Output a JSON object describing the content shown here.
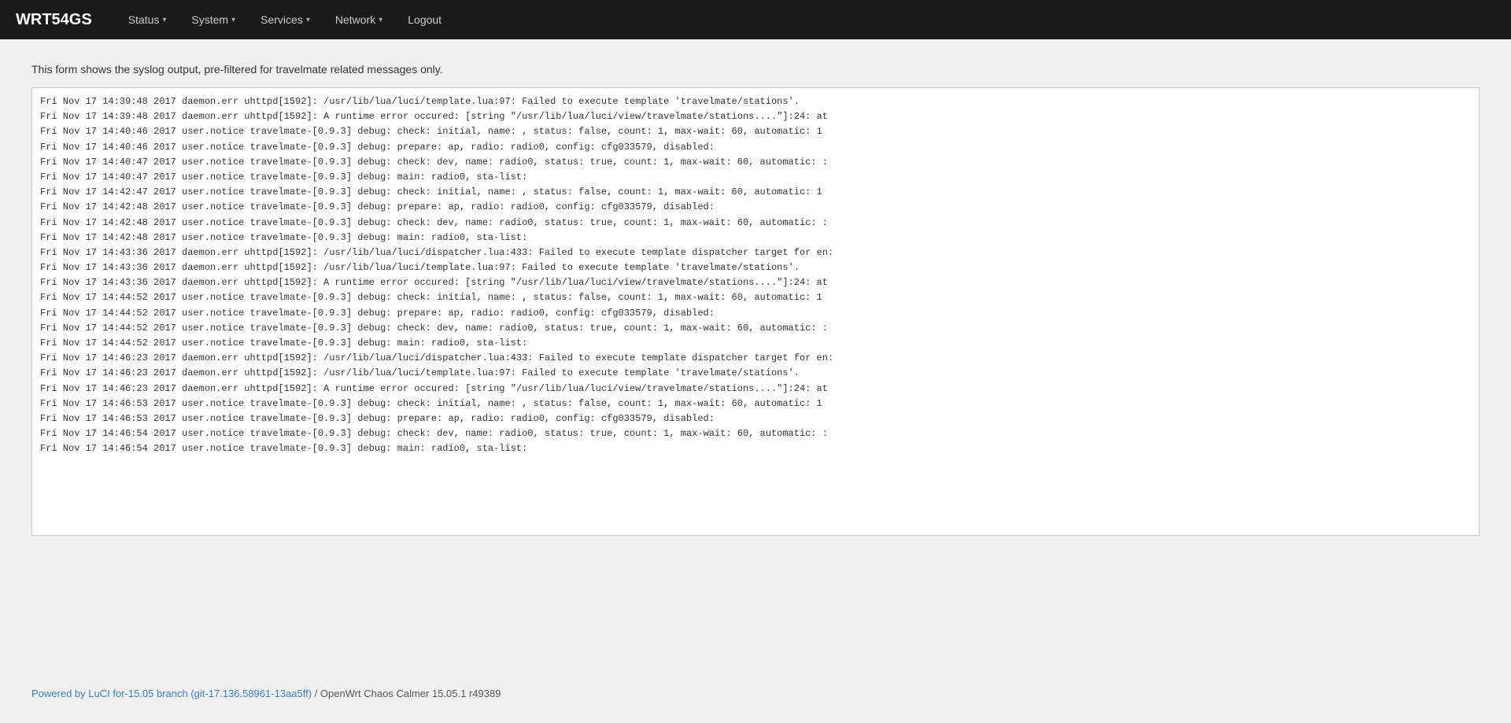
{
  "navbar": {
    "brand": "WRT54GS",
    "items": [
      {
        "label": "Status",
        "has_dropdown": true
      },
      {
        "label": "System",
        "has_dropdown": true
      },
      {
        "label": "Services",
        "has_dropdown": true
      },
      {
        "label": "Network",
        "has_dropdown": true
      },
      {
        "label": "Logout",
        "has_dropdown": false
      }
    ]
  },
  "description": "This form shows the syslog output, pre-filtered for travelmate related messages only.",
  "log_lines": [
    "Fri Nov 17 14:39:48 2017 daemon.err uhttpd[1592]: /usr/lib/lua/luci/template.lua:97: Failed to execute template 'travelmate/stations'.",
    "Fri Nov 17 14:39:48 2017 daemon.err uhttpd[1592]: A runtime error occured: [string \"/usr/lib/lua/luci/view/travelmate/stations....\"]:24: at",
    "Fri Nov 17 14:40:46 2017 user.notice travelmate-[0.9.3] debug: check: initial, name: , status: false, count: 1, max-wait: 60, automatic: 1",
    "Fri Nov 17 14:40:46 2017 user.notice travelmate-[0.9.3] debug: prepare: ap, radio: radio0, config: cfg033579, disabled:",
    "Fri Nov 17 14:40:47 2017 user.notice travelmate-[0.9.3] debug: check: dev, name:  radio0, status: true, count: 1, max-wait: 60, automatic: :",
    "Fri Nov 17 14:40:47 2017 user.notice travelmate-[0.9.3] debug: main:  radio0, sta-list:",
    "Fri Nov 17 14:42:47 2017 user.notice travelmate-[0.9.3] debug: check: initial, name: , status: false, count: 1, max-wait: 60, automatic: 1",
    "Fri Nov 17 14:42:48 2017 user.notice travelmate-[0.9.3] debug: prepare: ap, radio: radio0, config: cfg033579, disabled:",
    "Fri Nov 17 14:42:48 2017 user.notice travelmate-[0.9.3] debug: check: dev, name:  radio0, status: true, count: 1, max-wait: 60, automatic: :",
    "Fri Nov 17 14:42:48 2017 user.notice travelmate-[0.9.3] debug: main:  radio0, sta-list:",
    "Fri Nov 17 14:43:36 2017 daemon.err uhttpd[1592]: /usr/lib/lua/luci/dispatcher.lua:433: Failed to execute template dispatcher target for en:",
    "Fri Nov 17 14:43:36 2017 daemon.err uhttpd[1592]: /usr/lib/lua/luci/template.lua:97: Failed to execute template 'travelmate/stations'.",
    "Fri Nov 17 14:43:36 2017 daemon.err uhttpd[1592]: A runtime error occured: [string \"/usr/lib/lua/luci/view/travelmate/stations....\"]:24: at",
    "Fri Nov 17 14:44:52 2017 user.notice travelmate-[0.9.3] debug: check: initial, name: , status: false, count: 1, max-wait: 60, automatic: 1",
    "Fri Nov 17 14:44:52 2017 user.notice travelmate-[0.9.3] debug: prepare: ap, radio: radio0, config: cfg033579, disabled:",
    "Fri Nov 17 14:44:52 2017 user.notice travelmate-[0.9.3] debug: check: dev, name:  radio0, status: true, count: 1, max-wait: 60, automatic: :",
    "Fri Nov 17 14:44:52 2017 user.notice travelmate-[0.9.3] debug: main:  radio0, sta-list:",
    "Fri Nov 17 14:46:23 2017 daemon.err uhttpd[1592]: /usr/lib/lua/luci/dispatcher.lua:433: Failed to execute template dispatcher target for en:",
    "Fri Nov 17 14:46:23 2017 daemon.err uhttpd[1592]: /usr/lib/lua/luci/template.lua:97: Failed to execute template 'travelmate/stations'.",
    "Fri Nov 17 14:46:23 2017 daemon.err uhttpd[1592]: A runtime error occured: [string \"/usr/lib/lua/luci/view/travelmate/stations....\"]:24: at",
    "Fri Nov 17 14:46:53 2017 user.notice travelmate-[0.9.3] debug: check: initial, name: , status: false, count: 1, max-wait: 60, automatic: 1",
    "Fri Nov 17 14:46:53 2017 user.notice travelmate-[0.9.3] debug: prepare: ap, radio: radio0, config: cfg033579, disabled:",
    "Fri Nov 17 14:46:54 2017 user.notice travelmate-[0.9.3] debug: check: dev, name:  radio0, status: true, count: 1, max-wait: 60, automatic: :",
    "Fri Nov 17 14:46:54 2017 user.notice travelmate-[0.9.3] debug: main:  radio0, sta-list:"
  ],
  "footer": {
    "luci_link_text": "Powered by LuCI for-15.05 branch (git-17.136.58961-13aa5ff)",
    "luci_link_href": "#",
    "separator": " / ",
    "version_text": "OpenWrt Chaos Calmer 15.05.1 r49389"
  }
}
